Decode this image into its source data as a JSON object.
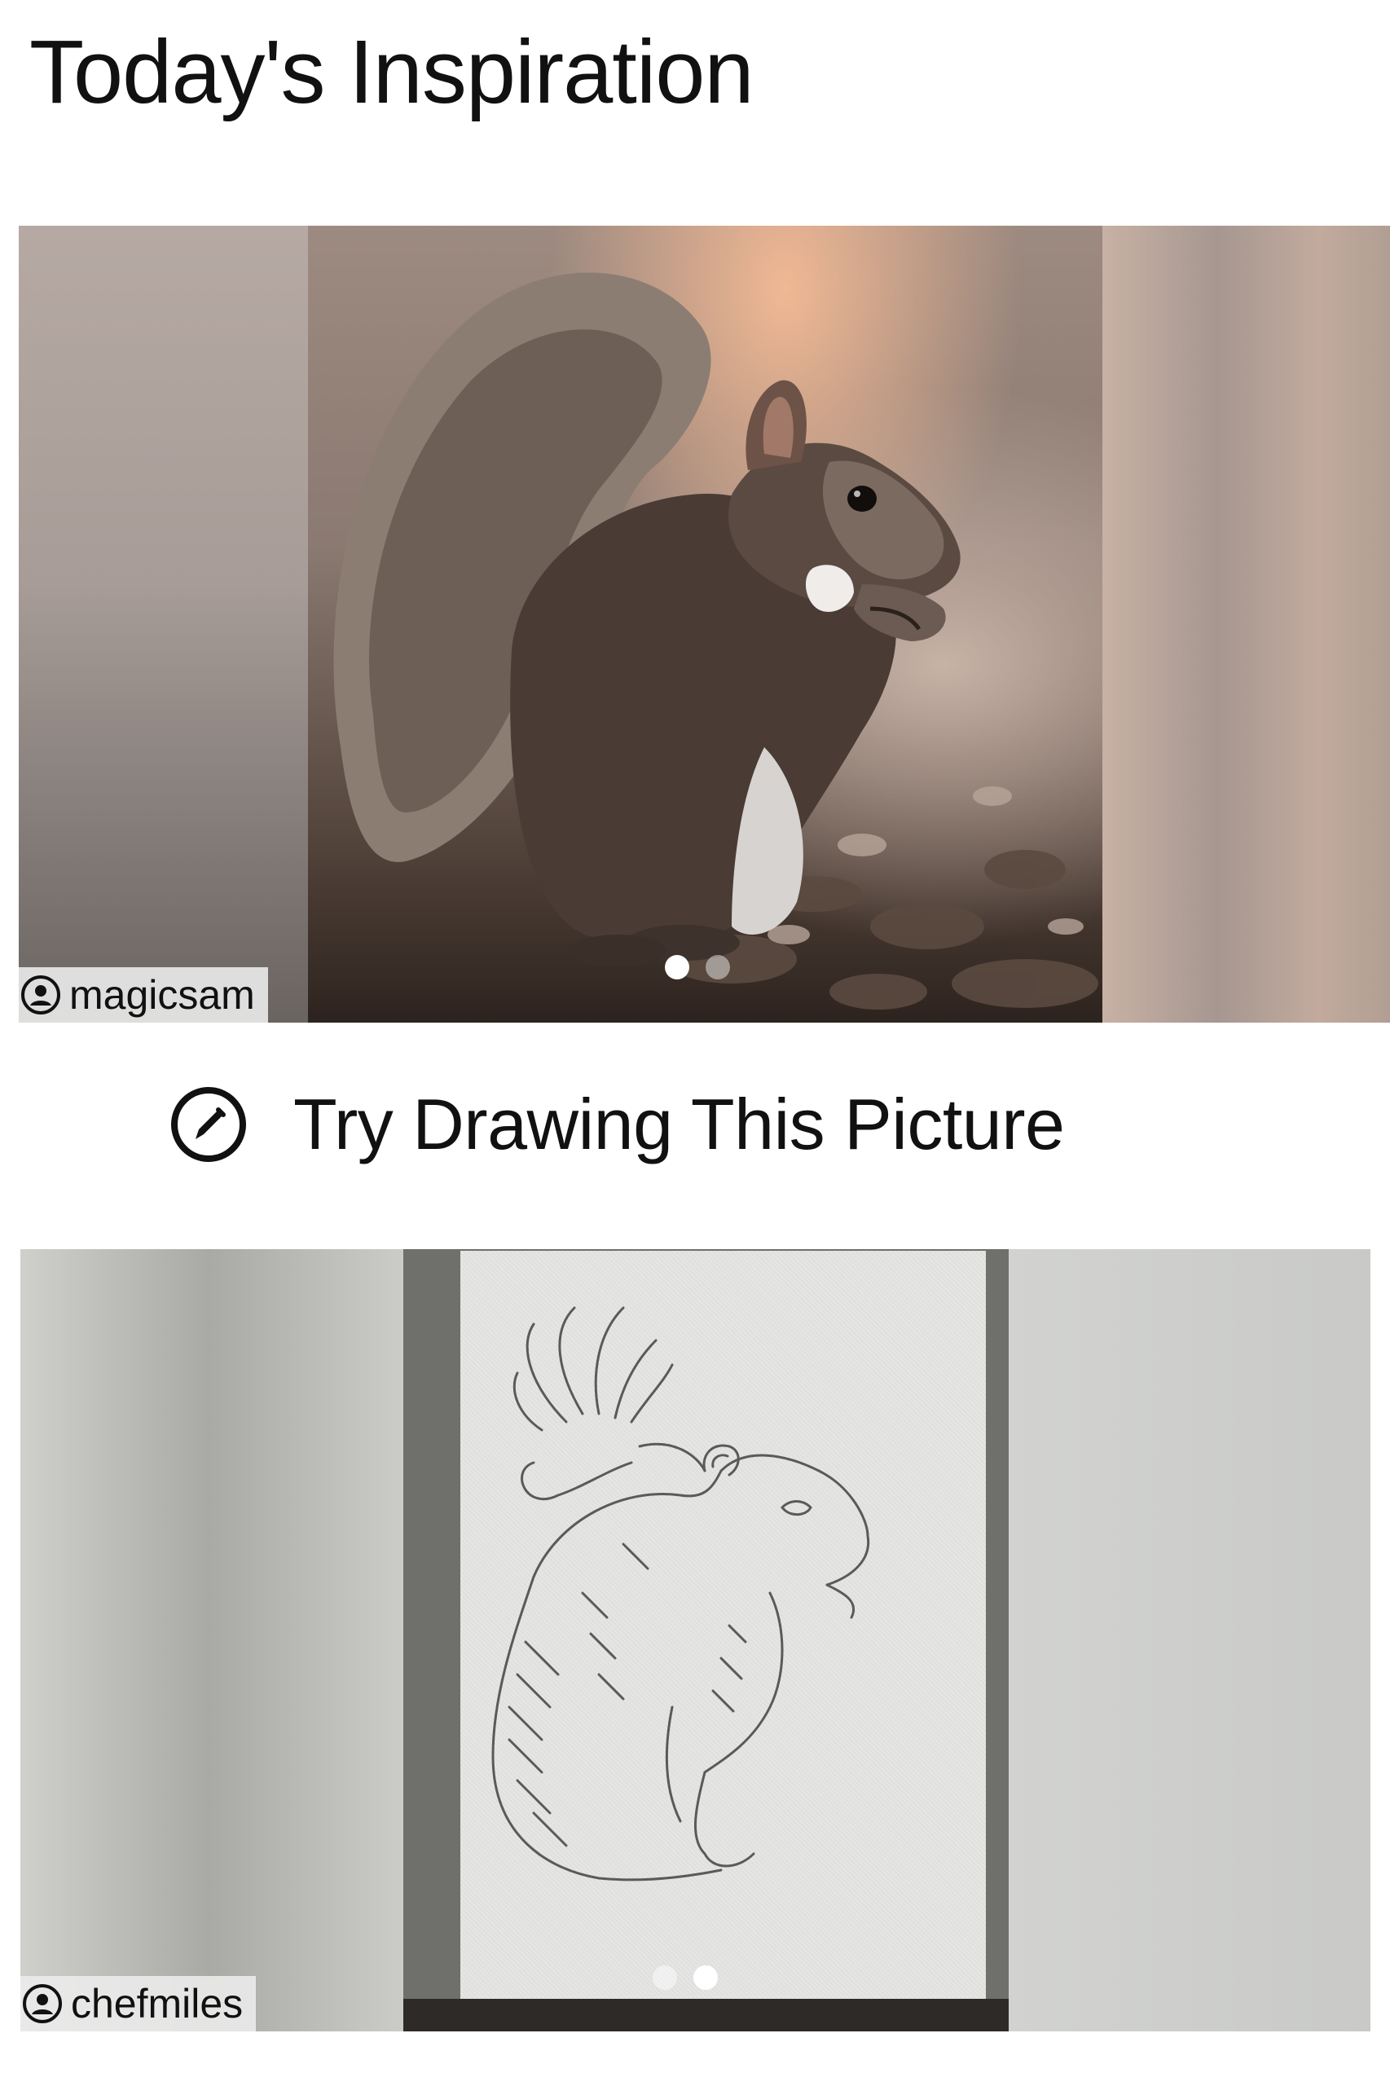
{
  "header": {
    "title": "Today's Inspiration"
  },
  "photo_card": {
    "username": "magicsam",
    "user_icon": "user-circle-icon",
    "image_subject": "squirrel-photo",
    "pagination": {
      "total": 2,
      "active_index": 0
    }
  },
  "action": {
    "label": "Try Drawing This Picture",
    "icon": "pencil-circle-icon"
  },
  "drawing_card": {
    "username": "chefmiles",
    "user_icon": "user-circle-icon",
    "image_subject": "squirrel-sketch",
    "pagination": {
      "total": 2,
      "active_index": 1
    }
  }
}
